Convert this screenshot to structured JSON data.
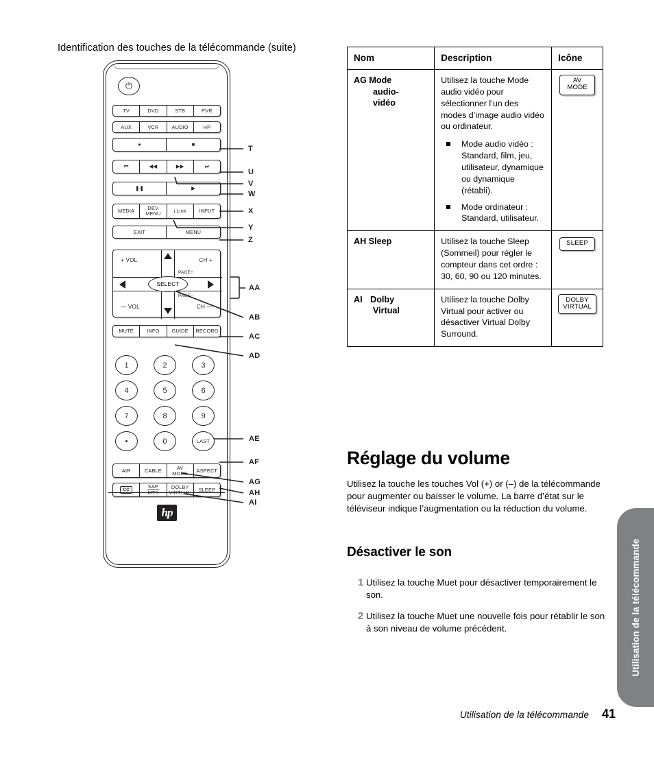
{
  "page": {
    "caption": "Identification des touches de la télécommande (suite)",
    "footer_text": "Utilisation de la télécommande",
    "footer_page": "41",
    "side_tab": "Utilisation de la télécommande"
  },
  "remote": {
    "power_glyph": "⏻",
    "hp_logo": "hp",
    "rows": [
      {
        "name": "device-row-1",
        "keys": [
          "TV",
          "DVD",
          "STB",
          "PVR"
        ]
      },
      {
        "name": "device-row-2",
        "keys": [
          "AUX",
          "VCR",
          "AUDIO",
          "HP"
        ]
      },
      {
        "name": "record-stop-row",
        "keys": [
          "●",
          "■"
        ]
      },
      {
        "name": "transport-row",
        "keys": [
          "⏮",
          "◀◀",
          "▶▶",
          "⏭"
        ]
      },
      {
        "name": "pause-play-row",
        "keys": [
          "❚❚",
          "▶"
        ]
      },
      {
        "name": "media-row",
        "keys": [
          "MEDIA",
          "DEV\nMENU",
          "i.Link",
          "INPUT"
        ]
      },
      {
        "name": "exit-menu-row",
        "keys": [
          "EXIT",
          "MENU"
        ]
      },
      {
        "name": "mute-info-row",
        "keys": [
          "MUTE",
          "INFO",
          "GUIDE",
          "RECORD"
        ]
      },
      {
        "name": "air-cable-row",
        "keys": [
          "AIR",
          "CABLE",
          "AV\nMODE",
          "ASPECT"
        ]
      },
      {
        "name": "cc-sleep-row",
        "keys": [
          "CC",
          "SAP/MTS",
          "DOLBY\nVIRTUAL",
          "SLEEP"
        ]
      }
    ],
    "dpad": {
      "vol_up": "+ VOL",
      "vol_down": "— VOL",
      "ch_up": "CH +",
      "ch_down": "CH —",
      "page_up": "PAGE+",
      "page_down": "PAGE–",
      "select": "SELECT"
    },
    "keypad": [
      "1",
      "2",
      "3",
      "4",
      "5",
      "6",
      "7",
      "8",
      "9",
      "•",
      "0",
      "LAST"
    ],
    "sap_top": "SAP",
    "sap_bottom": "MTS",
    "cc_label": "CC"
  },
  "callouts": [
    {
      "id": "T",
      "label": "T"
    },
    {
      "id": "U",
      "label": "U"
    },
    {
      "id": "V",
      "label": "V"
    },
    {
      "id": "W",
      "label": "W"
    },
    {
      "id": "X",
      "label": "X"
    },
    {
      "id": "Y",
      "label": "Y"
    },
    {
      "id": "Z",
      "label": "Z"
    },
    {
      "id": "AA",
      "label": "AA"
    },
    {
      "id": "AB",
      "label": "AB"
    },
    {
      "id": "AC",
      "label": "AC"
    },
    {
      "id": "AD",
      "label": "AD"
    },
    {
      "id": "AE",
      "label": "AE"
    },
    {
      "id": "AF",
      "label": "AF"
    },
    {
      "id": "AG",
      "label": "AG"
    },
    {
      "id": "AH",
      "label": "AH"
    },
    {
      "id": "AI",
      "label": "AI"
    }
  ],
  "table": {
    "headers": {
      "nom": "Nom",
      "description": "Description",
      "icone": "Icône"
    },
    "rows": [
      {
        "tag": "AG",
        "name_lines": [
          "Mode",
          "audio-",
          "vidéo"
        ],
        "description": "Utilisez la touche Mode audio vidéo pour sélectionner l’un des modes d’image audio vidéo ou ordinateur.",
        "bullets": [
          "Mode audio vidéo : Standard, film, jeu, utilisateur, dynamique ou dynamique (rétabli).",
          "Mode ordinateur : Standard, utilisateur."
        ],
        "icon": "AV\nMODE"
      },
      {
        "tag": "AH",
        "name_lines": [
          "Sleep"
        ],
        "description": "Utilisez la touche Sleep (Sommeil) pour régler le compteur dans cet ordre : 30, 60, 90 ou 120 minutes.",
        "bullets": [],
        "icon": "SLEEP"
      },
      {
        "tag": "AI",
        "name_lines": [
          "Dolby",
          "Virtual"
        ],
        "description": "Utilisez la touche Dolby Virtual pour activer ou désactiver Virtual Dolby Surround.",
        "bullets": [],
        "icon": "DOLBY\nVIRTUAL"
      }
    ]
  },
  "content": {
    "h1_volume": "Réglage du volume",
    "p_volume": "Utilisez la touche les touches Vol (+) or (–) de la télécommande pour augmenter ou baisser le volume. La barre d’état sur le téléviseur indique l’augmentation ou la réduction du volume.",
    "h2_mute": "Désactiver le son",
    "steps": [
      {
        "num": "1",
        "text": "Utilisez la touche Muet pour désactiver temporairement le son."
      },
      {
        "num": "2",
        "text": "Utilisez la touche Muet une nouvelle fois pour rétablir le son à son niveau de volume précédent."
      }
    ]
  }
}
